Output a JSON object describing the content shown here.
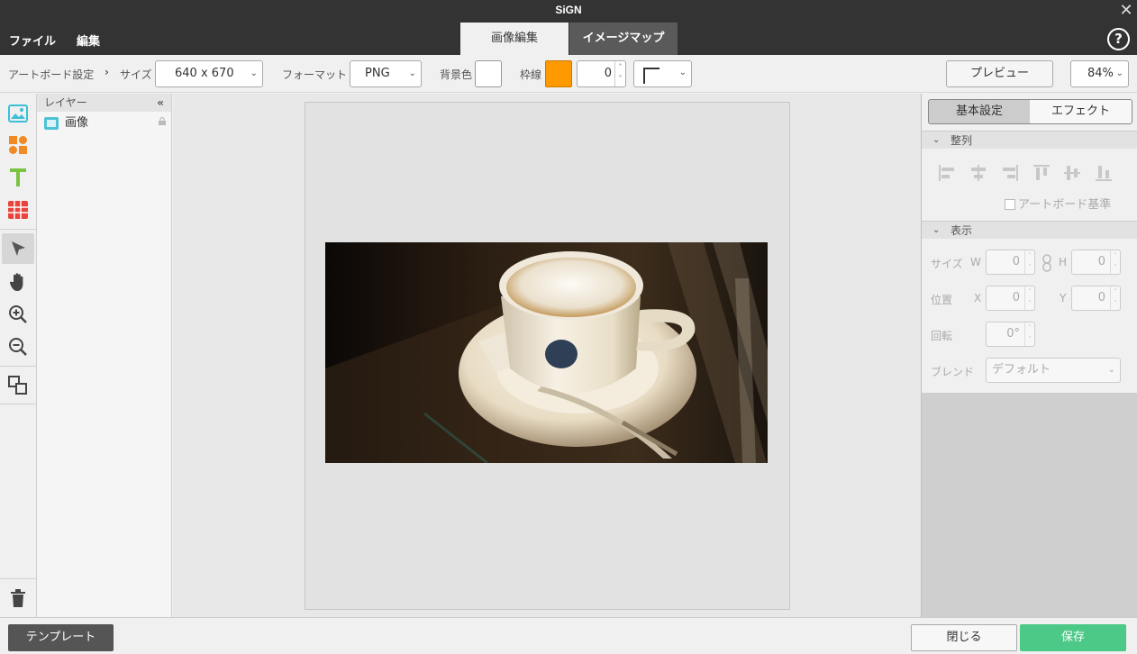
{
  "app": {
    "title": "SiGN",
    "close_glyph": "✕"
  },
  "menu": {
    "file": "ファイル",
    "edit": "編集"
  },
  "mode_tabs": {
    "image_edit": "画像編集",
    "image_map": "イメージマップ"
  },
  "help": {
    "glyph": "?"
  },
  "toolbar": {
    "artboard_settings": "アートボード設定",
    "breadcrumb_sep": "›",
    "size_label": "サイズ",
    "size_value": "640 x 670",
    "format_label": "フォーマット",
    "format_value": "PNG",
    "bgcolor_label": "背景色",
    "bgcolor": "#ffffff",
    "border_label": "枠線",
    "border_color": "#ff9900",
    "border_width": "0",
    "preview": "プレビュー",
    "zoom": "84%"
  },
  "tools": [
    {
      "name": "image-tool-icon"
    },
    {
      "name": "shape-tool-icon"
    },
    {
      "name": "text-tool-icon"
    },
    {
      "name": "table-tool-icon"
    },
    {
      "name": "select-tool-icon"
    },
    {
      "name": "hand-tool-icon"
    },
    {
      "name": "zoom-in-icon"
    },
    {
      "name": "zoom-out-icon"
    },
    {
      "name": "arrange-icon"
    },
    {
      "name": "trash-icon"
    }
  ],
  "layers": {
    "header": "レイヤー",
    "collapse": "«",
    "items": [
      {
        "label": "画像"
      }
    ]
  },
  "right_panel": {
    "tabs": {
      "basic": "基本設定",
      "effect": "エフェクト"
    },
    "align_section": "整列",
    "artboard_ref": "アートボード基準",
    "display_section": "表示",
    "size_label": "サイズ",
    "w_label": "W",
    "w_value": "0",
    "h_label": "H",
    "h_value": "0",
    "pos_label": "位置",
    "x_label": "X",
    "x_value": "0",
    "y_label": "Y",
    "y_value": "0",
    "rotate_label": "回転",
    "rotate_value": "0°",
    "blend_label": "ブレンド",
    "blend_value": "デフォルト"
  },
  "footer": {
    "template": "テンプレート",
    "close": "閉じる",
    "save": "保存"
  }
}
